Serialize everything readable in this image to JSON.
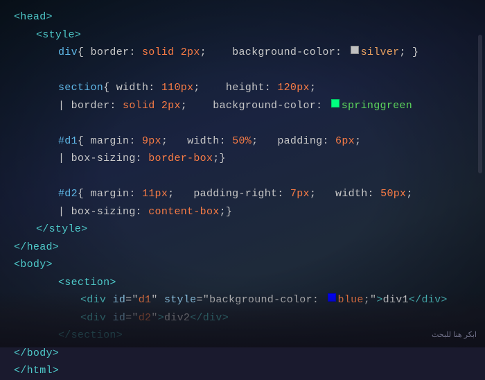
{
  "lines": [
    {
      "id": "line-head-close-tag",
      "indent": "",
      "parts": [
        {
          "type": "tag",
          "text": "<head>"
        }
      ]
    },
    {
      "id": "line-style-open",
      "indent": "    ",
      "parts": [
        {
          "type": "tag",
          "text": "<style>"
        }
      ]
    },
    {
      "id": "line-div-rule",
      "indent": "        ",
      "parts": [
        {
          "type": "selector",
          "text": "div"
        },
        {
          "type": "punct",
          "text": "{ "
        },
        {
          "type": "property",
          "text": "border"
        },
        {
          "type": "punct",
          "text": ": "
        },
        {
          "type": "value",
          "text": "solid 2px"
        },
        {
          "type": "punct",
          "text": ";    "
        },
        {
          "type": "property",
          "text": "background-color"
        },
        {
          "type": "punct",
          "text": ": "
        },
        {
          "type": "colorbox",
          "color": "silver"
        },
        {
          "type": "color-silver",
          "text": "silver"
        },
        {
          "type": "punct",
          "text": "; }"
        }
      ]
    },
    {
      "id": "line-blank-1",
      "indent": "",
      "parts": []
    },
    {
      "id": "line-section-rule1",
      "indent": "        ",
      "parts": [
        {
          "type": "selector",
          "text": "section"
        },
        {
          "type": "punct",
          "text": "{ "
        },
        {
          "type": "property",
          "text": "width"
        },
        {
          "type": "punct",
          "text": ": "
        },
        {
          "type": "value",
          "text": "110px"
        },
        {
          "type": "punct",
          "text": ";    "
        },
        {
          "type": "property",
          "text": "height"
        },
        {
          "type": "punct",
          "text": ": "
        },
        {
          "type": "value",
          "text": "120px"
        },
        {
          "type": "punct",
          "text": ";"
        }
      ]
    },
    {
      "id": "line-section-rule2",
      "indent": "        ",
      "parts": [
        {
          "type": "punct",
          "text": "| "
        },
        {
          "type": "property",
          "text": "border"
        },
        {
          "type": "punct",
          "text": ": "
        },
        {
          "type": "value",
          "text": "solid 2px"
        },
        {
          "type": "punct",
          "text": ";    "
        },
        {
          "type": "property",
          "text": "background-color"
        },
        {
          "type": "punct",
          "text": ": "
        },
        {
          "type": "colorbox",
          "color": "spring"
        },
        {
          "type": "color-spring",
          "text": "springgreen"
        }
      ]
    },
    {
      "id": "line-blank-2",
      "indent": "",
      "parts": []
    },
    {
      "id": "line-d1-rule1",
      "indent": "        ",
      "parts": [
        {
          "type": "selector-id",
          "text": "#d1"
        },
        {
          "type": "punct",
          "text": "{ "
        },
        {
          "type": "property",
          "text": "margin"
        },
        {
          "type": "punct",
          "text": ": "
        },
        {
          "type": "value",
          "text": "9px"
        },
        {
          "type": "punct",
          "text": ";   "
        },
        {
          "type": "property",
          "text": "width"
        },
        {
          "type": "punct",
          "text": ": "
        },
        {
          "type": "value",
          "text": "50%"
        },
        {
          "type": "punct",
          "text": ";   "
        },
        {
          "type": "property",
          "text": "padding"
        },
        {
          "type": "punct",
          "text": ": "
        },
        {
          "type": "value",
          "text": "6px"
        },
        {
          "type": "punct",
          "text": ";"
        }
      ]
    },
    {
      "id": "line-d1-rule2",
      "indent": "        ",
      "parts": [
        {
          "type": "punct",
          "text": "| "
        },
        {
          "type": "property",
          "text": "box-sizing"
        },
        {
          "type": "punct",
          "text": ": "
        },
        {
          "type": "value",
          "text": "border-box"
        },
        {
          "type": "punct",
          "text": ";}"
        }
      ]
    },
    {
      "id": "line-blank-3",
      "indent": "",
      "parts": []
    },
    {
      "id": "line-d2-rule1",
      "indent": "        ",
      "parts": [
        {
          "type": "selector-id",
          "text": "#d2"
        },
        {
          "type": "punct",
          "text": "{ "
        },
        {
          "type": "property",
          "text": "margin"
        },
        {
          "type": "punct",
          "text": ": "
        },
        {
          "type": "value",
          "text": "11px"
        },
        {
          "type": "punct",
          "text": ";   "
        },
        {
          "type": "property",
          "text": "padding-right"
        },
        {
          "type": "punct",
          "text": ": "
        },
        {
          "type": "value",
          "text": "7px"
        },
        {
          "type": "punct",
          "text": ";   "
        },
        {
          "type": "property",
          "text": "width"
        },
        {
          "type": "punct",
          "text": ": "
        },
        {
          "type": "value",
          "text": "50px"
        },
        {
          "type": "punct",
          "text": ";"
        }
      ]
    },
    {
      "id": "line-d2-rule2",
      "indent": "        ",
      "parts": [
        {
          "type": "punct",
          "text": "| "
        },
        {
          "type": "property",
          "text": "box-sizing"
        },
        {
          "type": "punct",
          "text": ": "
        },
        {
          "type": "value",
          "text": "content-box"
        },
        {
          "type": "punct",
          "text": ";}"
        }
      ]
    },
    {
      "id": "line-style-close",
      "indent": "    ",
      "parts": [
        {
          "type": "tag",
          "text": "</style>"
        }
      ]
    },
    {
      "id": "line-head-close",
      "indent": "",
      "parts": [
        {
          "type": "tag",
          "text": "</head>"
        }
      ]
    },
    {
      "id": "line-body-open",
      "indent": "",
      "parts": [
        {
          "type": "tag",
          "text": "<body>"
        }
      ]
    },
    {
      "id": "line-section-open",
      "indent": "        ",
      "parts": [
        {
          "type": "tag",
          "text": "<section>"
        }
      ]
    },
    {
      "id": "line-div1",
      "indent": "            ",
      "parts": [
        {
          "type": "tag",
          "text": "<div "
        },
        {
          "type": "attr-name",
          "text": "id"
        },
        {
          "type": "punct",
          "text": "=\""
        },
        {
          "type": "attr-value",
          "text": "d1"
        },
        {
          "type": "punct",
          "text": "\" "
        },
        {
          "type": "attr-name",
          "text": "style"
        },
        {
          "type": "punct",
          "text": "=\""
        },
        {
          "type": "property",
          "text": "background-color"
        },
        {
          "type": "punct",
          "text": ": "
        },
        {
          "type": "colorbox",
          "color": "blue"
        },
        {
          "type": "attr-value",
          "text": "blue"
        },
        {
          "type": "punct",
          "text": ";\""
        },
        {
          "type": "tag",
          "text": ">"
        },
        {
          "type": "text-content",
          "text": "div1"
        },
        {
          "type": "tag",
          "text": "</div>"
        }
      ]
    },
    {
      "id": "line-div2",
      "indent": "            ",
      "parts": [
        {
          "type": "tag",
          "text": "<div "
        },
        {
          "type": "attr-name",
          "text": "id"
        },
        {
          "type": "punct",
          "text": "=\""
        },
        {
          "type": "attr-value",
          "text": "d2"
        },
        {
          "type": "punct",
          "text": "\""
        },
        {
          "type": "tag",
          "text": ">"
        },
        {
          "type": "text-content",
          "text": "div2"
        },
        {
          "type": "tag",
          "text": "</div>"
        }
      ]
    },
    {
      "id": "line-section-close",
      "indent": "        ",
      "parts": [
        {
          "type": "tag",
          "text": "</section>"
        }
      ]
    },
    {
      "id": "line-body-close",
      "indent": "",
      "parts": [
        {
          "type": "tag",
          "text": "</body>"
        }
      ]
    },
    {
      "id": "line-html-close",
      "indent": "",
      "parts": [
        {
          "type": "tag",
          "text": "</html>"
        }
      ]
    }
  ],
  "watermark": {
    "text": "ابكر هنا للبحث"
  },
  "colors": {
    "tag": "#4ec9c9",
    "selector": "#5fb8e8",
    "property": "#c8c8c8",
    "value": "#f97c45",
    "color_silver": "#e8a060",
    "color_spring": "#5cd65c",
    "background": "#0d1b2a"
  }
}
